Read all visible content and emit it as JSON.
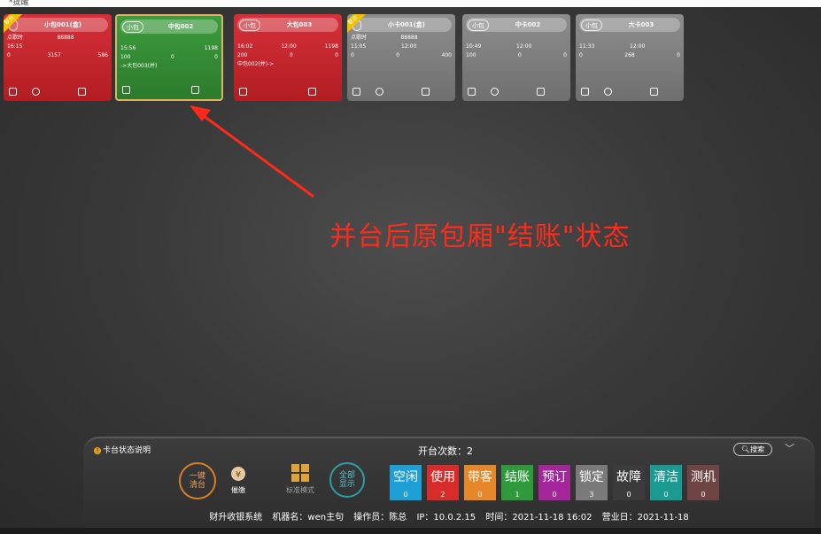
{
  "topbar": {
    "crumb": "*提醒"
  },
  "cards": [
    {
      "id": "card-xiaobao001",
      "color": "red",
      "pill": "",
      "name": "小包001(盒)",
      "ribbon": "联台",
      "rows": [
        [
          "点歌时",
          "88888",
          ""
        ],
        [
          "16:15",
          "",
          ""
        ],
        [
          "0",
          "3157",
          "586"
        ]
      ],
      "note": ""
    },
    {
      "id": "card-zhongbao002",
      "color": "green",
      "pill": "小包",
      "name": "中包002",
      "ribbon": "",
      "rows": [
        [
          "",
          "",
          ""
        ],
        [
          "15:56",
          "",
          "1198"
        ],
        [
          "100",
          "0",
          "0"
        ]
      ],
      "note": "->大包003(并)"
    },
    {
      "id": "card-dabao003",
      "color": "red",
      "pill": "小包",
      "name": "大包003",
      "ribbon": "",
      "rows": [
        [
          "",
          "",
          ""
        ],
        [
          "16:02",
          "12:00",
          "1198"
        ],
        [
          "200",
          "0",
          "0"
        ]
      ],
      "note": "中包002(并)->"
    },
    {
      "id": "card-xiaoka001",
      "color": "gray",
      "pill": "",
      "name": "小卡001(盒)",
      "ribbon": "联台",
      "rows": [
        [
          "点歌时",
          "88888",
          ""
        ],
        [
          "11:05",
          "12:00",
          ""
        ],
        [
          "0",
          "0",
          "400"
        ]
      ],
      "note": ""
    },
    {
      "id": "card-zhongka002",
      "color": "gray",
      "pill": "小包",
      "name": "中卡002",
      "ribbon": "",
      "rows": [
        [
          "",
          "",
          ""
        ],
        [
          "10:49",
          "12:00",
          ""
        ],
        [
          "100",
          "0",
          "0"
        ]
      ],
      "note": ""
    },
    {
      "id": "card-daka003",
      "color": "gray",
      "pill": "小包",
      "name": "大卡003",
      "ribbon": "",
      "rows": [
        [
          "",
          "",
          ""
        ],
        [
          "11:33",
          "12:00",
          ""
        ],
        [
          "0",
          "268",
          "0"
        ]
      ],
      "note": ""
    }
  ],
  "annotation": "并台后原包厢\"结账\"状态",
  "panel": {
    "legend": "卡台状态说明",
    "count_label": "开台次数：2",
    "search": "搜索",
    "clear_all": [
      "一键",
      "清台"
    ],
    "tools": [
      {
        "name": "催缴"
      },
      {
        "name": "标准模式"
      }
    ],
    "show_all": [
      "全部",
      "显示"
    ],
    "statuses": [
      {
        "label": "空闲",
        "count": "0",
        "color": "#1e9fd6"
      },
      {
        "label": "使用",
        "count": "2",
        "color": "#d62c2c"
      },
      {
        "label": "带客",
        "count": "0",
        "color": "#e6882a"
      },
      {
        "label": "结账",
        "count": "1",
        "color": "#2f9a3c"
      },
      {
        "label": "预订",
        "count": "0",
        "color": "#a5259a"
      },
      {
        "label": "锁定",
        "count": "3",
        "color": "#7a7a7a"
      },
      {
        "label": "故障",
        "count": "0",
        "color": "#3b3b3b"
      },
      {
        "label": "清洁",
        "count": "0",
        "color": "#1a9a90"
      },
      {
        "label": "测机",
        "count": "0",
        "color": "#6e4444"
      }
    ],
    "footer": {
      "system": "财升收银系统",
      "machine": "机器名：wen主句",
      "operator": "操作员：陈总",
      "ip": "IP：10.0.2.15",
      "time": "时间：2021-11-18 16:02",
      "bizday": "营业日：2021-11-18"
    }
  }
}
